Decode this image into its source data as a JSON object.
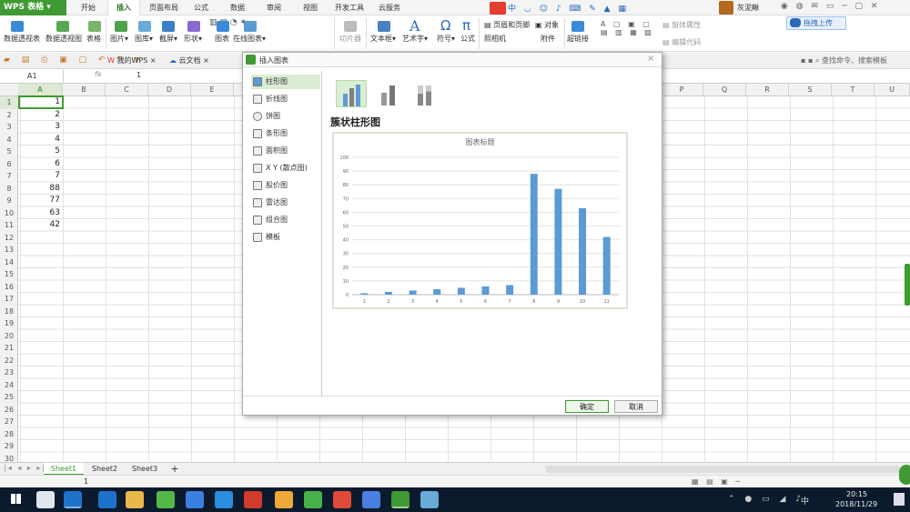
{
  "app": {
    "name": "WPS 表格"
  },
  "menu_tabs": [
    "开始",
    "插入",
    "页面布局",
    "公式",
    "数据",
    "审阅",
    "视图",
    "开发工具",
    "云服务"
  ],
  "active_tab": "插入",
  "user": {
    "name": "灰泥鳅",
    "upload_label": "拖拽上传"
  },
  "ribbon": {
    "buttons": [
      "数据透视表",
      "数据透视图",
      "表格",
      "图片▾",
      "图库▾",
      "截屏▾",
      "形状▾",
      "图表",
      "在线图表▾",
      "切片器",
      "文本框▾",
      "艺术字▾",
      "符号▾",
      "公式",
      "照相机",
      "附件",
      "超链接"
    ],
    "right_buttons": [
      "页眉和页脚",
      "对象",
      "窗体属性",
      "编辑代码"
    ]
  },
  "doc_tabs": [
    "我的WPS",
    "云文档"
  ],
  "search_label": "查找命令、搜索模板",
  "formula_bar": {
    "cell_ref": "A1",
    "fx": "fx",
    "value": "1"
  },
  "columns": [
    "A",
    "B",
    "C",
    "D",
    "E",
    "P",
    "Q",
    "R",
    "S",
    "T",
    "U"
  ],
  "rows": [
    "1",
    "2",
    "3",
    "4",
    "5",
    "6",
    "7",
    "8",
    "9",
    "10",
    "11",
    "12",
    "13",
    "14",
    "15",
    "16",
    "17",
    "18",
    "19",
    "20",
    "21",
    "22",
    "23",
    "24",
    "25",
    "26",
    "27",
    "28",
    "29",
    "30"
  ],
  "cells_a": [
    "1",
    "2",
    "3",
    "4",
    "5",
    "6",
    "7",
    "88",
    "77",
    "63",
    "42"
  ],
  "sheets": [
    "Sheet1",
    "Sheet2",
    "Sheet3"
  ],
  "status_left": "1",
  "dialog": {
    "title": "插入图表",
    "chart_types": [
      "柱形图",
      "折线图",
      "饼图",
      "条形图",
      "面积图",
      "X Y (散点图)",
      "股价图",
      "雷达图",
      "组合图",
      "模板"
    ],
    "subtype_title": "簇状柱形图",
    "ok_label": "确定",
    "cancel_label": "取消"
  },
  "chart_data": {
    "type": "bar",
    "title": "图表标题",
    "categories": [
      "1",
      "2",
      "3",
      "4",
      "5",
      "6",
      "7",
      "8",
      "9",
      "10",
      "11"
    ],
    "values": [
      1,
      2,
      3,
      4,
      5,
      6,
      7,
      88,
      77,
      63,
      42
    ],
    "ylim": [
      0,
      100
    ],
    "yticks": [
      "0",
      "10",
      "20",
      "30",
      "40",
      "50",
      "60",
      "70",
      "80",
      "90",
      "100"
    ],
    "bar_color": "#5b9bd5",
    "grid": true
  },
  "taskbar": {
    "time": "20:15",
    "date": "2018/11/29",
    "ime": "中"
  },
  "colors": {
    "accent": "#3f9a33",
    "selection": "#dbecd4"
  }
}
